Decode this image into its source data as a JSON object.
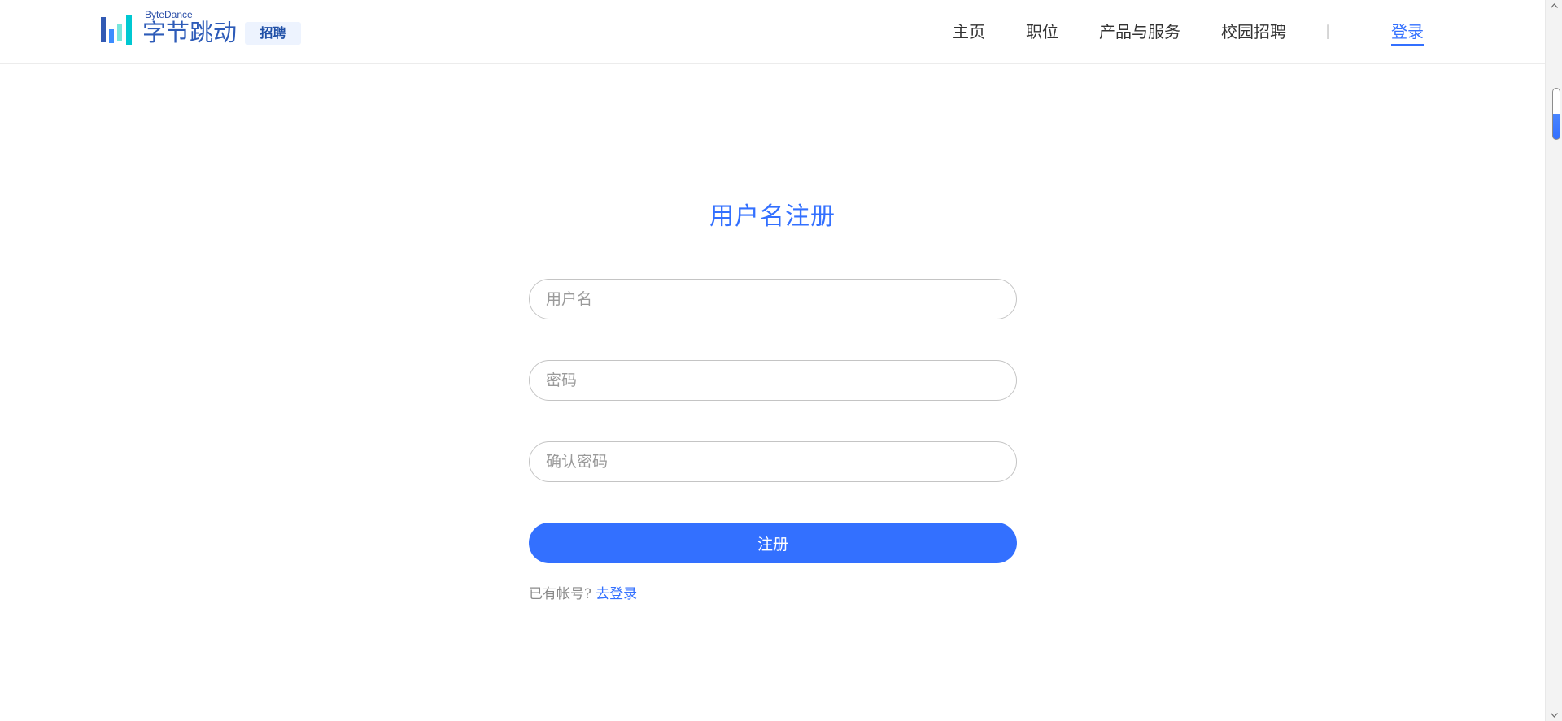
{
  "theme": {
    "accent": "#3370ff",
    "nav_text": "#333333",
    "muted_text": "#8a8a8a",
    "logo_blue": "#2d5bb8",
    "badge_background": "#edf3fe"
  },
  "icons": {
    "logo": "bytedance-logo-icon",
    "scroll_up": "chevron-up-icon",
    "scroll_down": "chevron-down-icon"
  },
  "header": {
    "logo": {
      "brand_en": "ByteDance",
      "brand_cn": "字节跳动",
      "badge": "招聘"
    },
    "nav": [
      {
        "label": "主页"
      },
      {
        "label": "职位"
      },
      {
        "label": "产品与服务"
      },
      {
        "label": "校园招聘"
      }
    ],
    "separator": "|",
    "login": "登录"
  },
  "register_form": {
    "title": "用户名注册",
    "username": {
      "placeholder": "用户名"
    },
    "password": {
      "placeholder": "密码"
    },
    "confirm_password": {
      "placeholder": "确认密码"
    },
    "submit_label": "注册",
    "footer": {
      "prompt": "已有帐号?",
      "login_link": "去登录"
    }
  }
}
